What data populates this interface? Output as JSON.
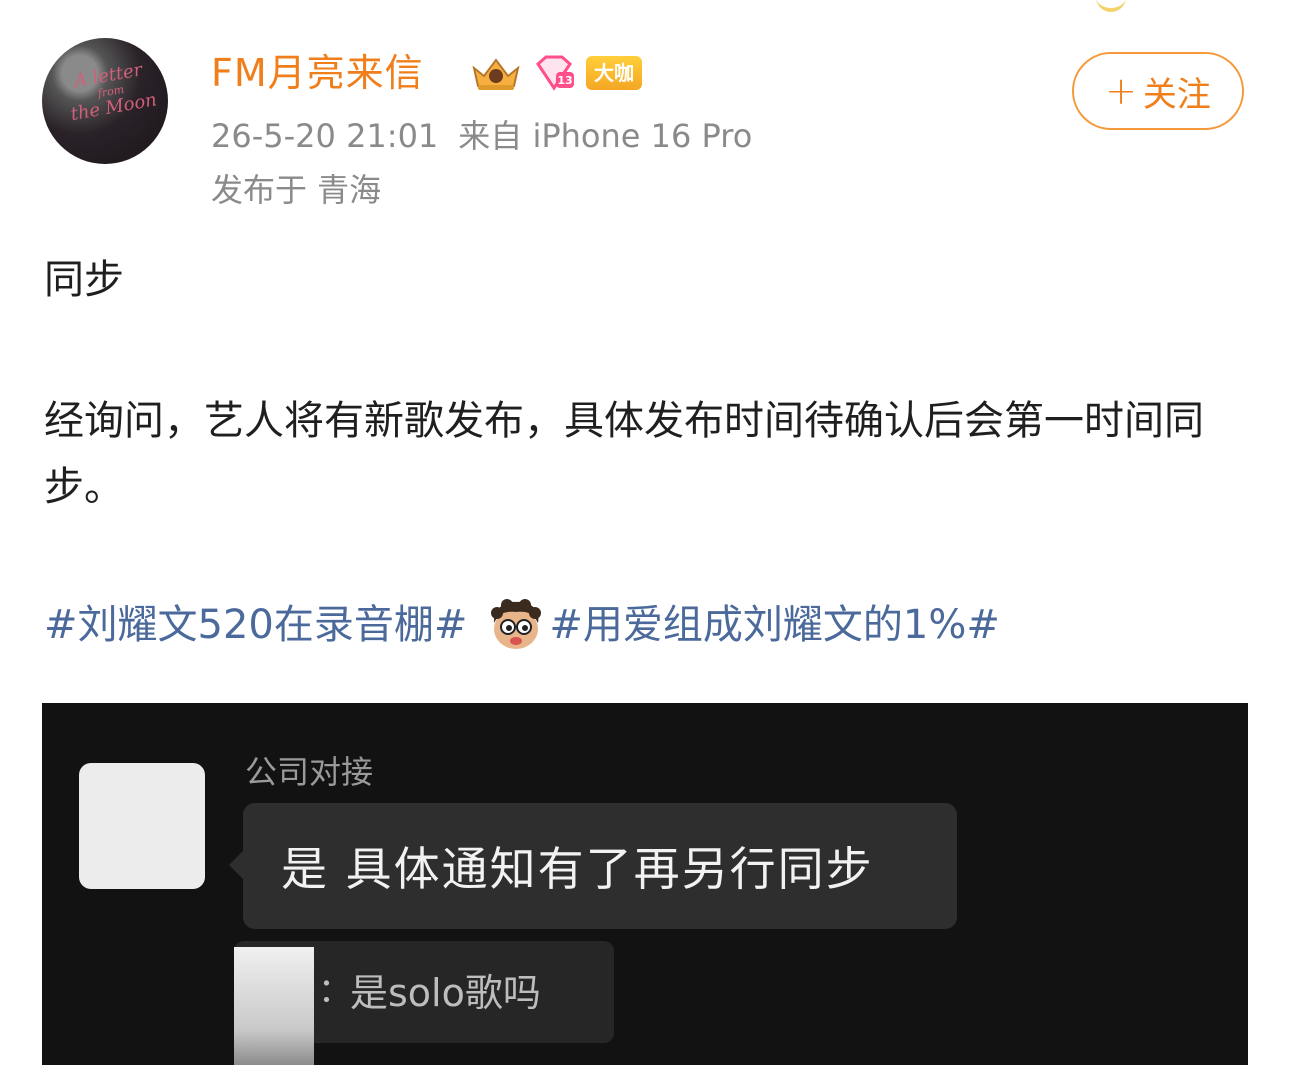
{
  "post": {
    "author": {
      "name": "FM月亮来信",
      "avatar_text": [
        "A letter",
        "from",
        "the Moon"
      ],
      "level_badge": "大咖"
    },
    "meta": {
      "timestamp": "26-5-20 21:01",
      "source": "来自 iPhone 16 Pro",
      "location": "发布于 青海"
    },
    "follow_button": {
      "plus": "+",
      "label": "关注"
    },
    "content": {
      "title": "同步",
      "body": "经询问，艺人将有新歌发布，具体发布时间待确认后会第一时间同步。",
      "hashtags": [
        "#刘耀文520在录音棚#",
        "#用爱组成刘耀文的1%#"
      ]
    }
  },
  "embedded_chat": {
    "sender": "公司对接",
    "message": "是 具体通知有了再另行同步",
    "quoted_colon": "：",
    "quoted_message": "是solo歌吗"
  },
  "colors": {
    "brand_orange": "#f07e1a",
    "hashtag_blue": "#4b6a9b",
    "meta_gray": "#8a8a8a"
  }
}
